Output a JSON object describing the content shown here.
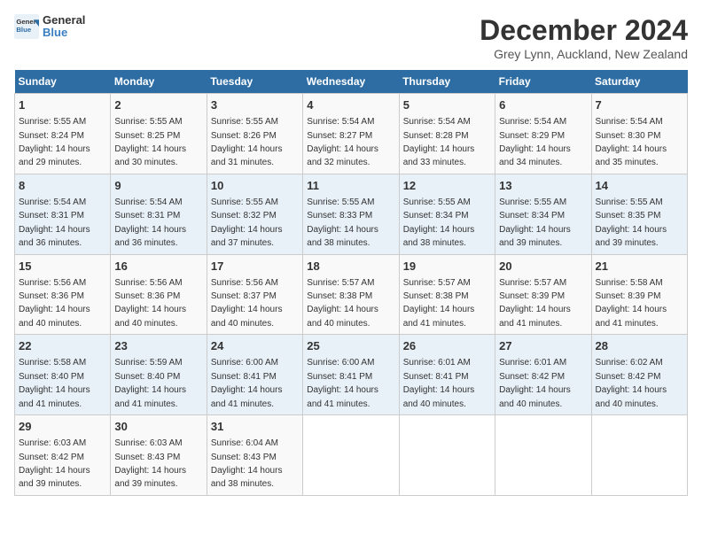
{
  "logo": {
    "line1": "General",
    "line2": "Blue"
  },
  "title": "December 2024",
  "subtitle": "Grey Lynn, Auckland, New Zealand",
  "days_header": [
    "Sunday",
    "Monday",
    "Tuesday",
    "Wednesday",
    "Thursday",
    "Friday",
    "Saturday"
  ],
  "weeks": [
    [
      {
        "num": "1",
        "rise": "5:55 AM",
        "set": "8:24 PM",
        "daylight": "14 hours and 29 minutes."
      },
      {
        "num": "2",
        "rise": "5:55 AM",
        "set": "8:25 PM",
        "daylight": "14 hours and 30 minutes."
      },
      {
        "num": "3",
        "rise": "5:55 AM",
        "set": "8:26 PM",
        "daylight": "14 hours and 31 minutes."
      },
      {
        "num": "4",
        "rise": "5:54 AM",
        "set": "8:27 PM",
        "daylight": "14 hours and 32 minutes."
      },
      {
        "num": "5",
        "rise": "5:54 AM",
        "set": "8:28 PM",
        "daylight": "14 hours and 33 minutes."
      },
      {
        "num": "6",
        "rise": "5:54 AM",
        "set": "8:29 PM",
        "daylight": "14 hours and 34 minutes."
      },
      {
        "num": "7",
        "rise": "5:54 AM",
        "set": "8:30 PM",
        "daylight": "14 hours and 35 minutes."
      }
    ],
    [
      {
        "num": "8",
        "rise": "5:54 AM",
        "set": "8:31 PM",
        "daylight": "14 hours and 36 minutes."
      },
      {
        "num": "9",
        "rise": "5:54 AM",
        "set": "8:31 PM",
        "daylight": "14 hours and 36 minutes."
      },
      {
        "num": "10",
        "rise": "5:55 AM",
        "set": "8:32 PM",
        "daylight": "14 hours and 37 minutes."
      },
      {
        "num": "11",
        "rise": "5:55 AM",
        "set": "8:33 PM",
        "daylight": "14 hours and 38 minutes."
      },
      {
        "num": "12",
        "rise": "5:55 AM",
        "set": "8:34 PM",
        "daylight": "14 hours and 38 minutes."
      },
      {
        "num": "13",
        "rise": "5:55 AM",
        "set": "8:34 PM",
        "daylight": "14 hours and 39 minutes."
      },
      {
        "num": "14",
        "rise": "5:55 AM",
        "set": "8:35 PM",
        "daylight": "14 hours and 39 minutes."
      }
    ],
    [
      {
        "num": "15",
        "rise": "5:56 AM",
        "set": "8:36 PM",
        "daylight": "14 hours and 40 minutes."
      },
      {
        "num": "16",
        "rise": "5:56 AM",
        "set": "8:36 PM",
        "daylight": "14 hours and 40 minutes."
      },
      {
        "num": "17",
        "rise": "5:56 AM",
        "set": "8:37 PM",
        "daylight": "14 hours and 40 minutes."
      },
      {
        "num": "18",
        "rise": "5:57 AM",
        "set": "8:38 PM",
        "daylight": "14 hours and 40 minutes."
      },
      {
        "num": "19",
        "rise": "5:57 AM",
        "set": "8:38 PM",
        "daylight": "14 hours and 41 minutes."
      },
      {
        "num": "20",
        "rise": "5:57 AM",
        "set": "8:39 PM",
        "daylight": "14 hours and 41 minutes."
      },
      {
        "num": "21",
        "rise": "5:58 AM",
        "set": "8:39 PM",
        "daylight": "14 hours and 41 minutes."
      }
    ],
    [
      {
        "num": "22",
        "rise": "5:58 AM",
        "set": "8:40 PM",
        "daylight": "14 hours and 41 minutes."
      },
      {
        "num": "23",
        "rise": "5:59 AM",
        "set": "8:40 PM",
        "daylight": "14 hours and 41 minutes."
      },
      {
        "num": "24",
        "rise": "6:00 AM",
        "set": "8:41 PM",
        "daylight": "14 hours and 41 minutes."
      },
      {
        "num": "25",
        "rise": "6:00 AM",
        "set": "8:41 PM",
        "daylight": "14 hours and 41 minutes."
      },
      {
        "num": "26",
        "rise": "6:01 AM",
        "set": "8:41 PM",
        "daylight": "14 hours and 40 minutes."
      },
      {
        "num": "27",
        "rise": "6:01 AM",
        "set": "8:42 PM",
        "daylight": "14 hours and 40 minutes."
      },
      {
        "num": "28",
        "rise": "6:02 AM",
        "set": "8:42 PM",
        "daylight": "14 hours and 40 minutes."
      }
    ],
    [
      {
        "num": "29",
        "rise": "6:03 AM",
        "set": "8:42 PM",
        "daylight": "14 hours and 39 minutes."
      },
      {
        "num": "30",
        "rise": "6:03 AM",
        "set": "8:43 PM",
        "daylight": "14 hours and 39 minutes."
      },
      {
        "num": "31",
        "rise": "6:04 AM",
        "set": "8:43 PM",
        "daylight": "14 hours and 38 minutes."
      },
      null,
      null,
      null,
      null
    ]
  ],
  "labels": {
    "sunrise": "Sunrise:",
    "sunset": "Sunset:",
    "daylight": "Daylight:"
  }
}
